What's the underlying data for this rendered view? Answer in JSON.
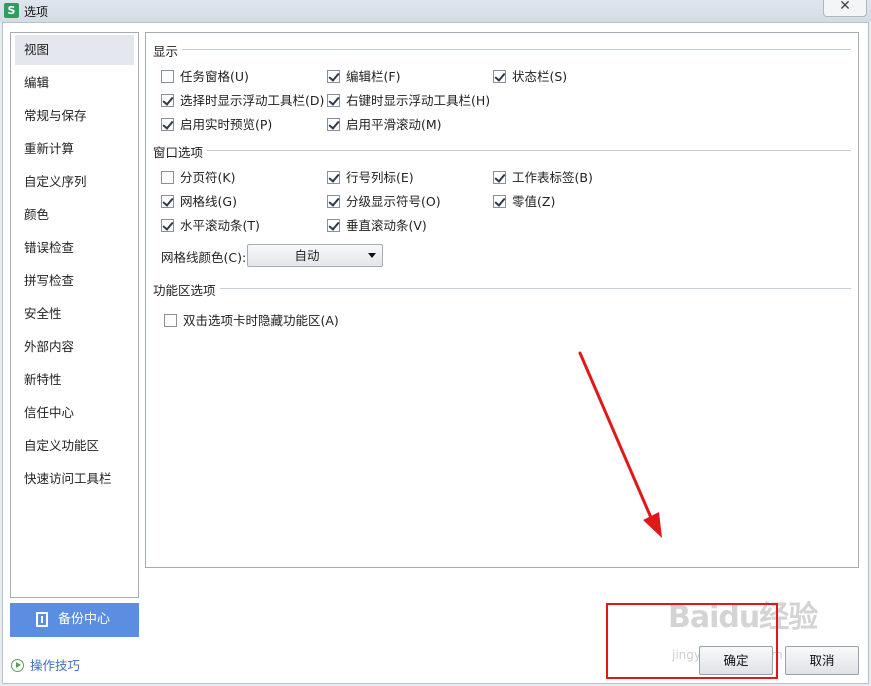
{
  "window": {
    "title": "选项",
    "app_icon_letter": "S",
    "close_glyph": "✕"
  },
  "sidebar": {
    "items": [
      {
        "label": "视图",
        "active": true
      },
      {
        "label": "编辑"
      },
      {
        "label": "常规与保存"
      },
      {
        "label": "重新计算"
      },
      {
        "label": "自定义序列"
      },
      {
        "label": "颜色"
      },
      {
        "label": "错误检查"
      },
      {
        "label": "拼写检查"
      },
      {
        "label": "安全性"
      },
      {
        "label": "外部内容"
      },
      {
        "label": "新特性"
      },
      {
        "label": "信任中心"
      },
      {
        "label": "自定义功能区"
      },
      {
        "label": "快速访问工具栏"
      }
    ]
  },
  "display": {
    "title": "显示",
    "options": [
      {
        "label": "任务窗格(U)",
        "checked": false
      },
      {
        "label": "编辑栏(F)",
        "checked": true
      },
      {
        "label": "状态栏(S)",
        "checked": true
      },
      {
        "label": "选择时显示浮动工具栏(D)",
        "checked": true
      },
      {
        "label": "右键时显示浮动工具栏(H)",
        "checked": true
      },
      {
        "label": "启用实时预览(P)",
        "checked": true
      },
      {
        "label": "启用平滑滚动(M)",
        "checked": true
      }
    ]
  },
  "window_options": {
    "title": "窗口选项",
    "options": [
      {
        "label": "分页符(K)",
        "checked": false
      },
      {
        "label": "行号列标(E)",
        "checked": true
      },
      {
        "label": "工作表标签(B)",
        "checked": true
      },
      {
        "label": "网格线(G)",
        "checked": true
      },
      {
        "label": "分级显示符号(O)",
        "checked": true
      },
      {
        "label": "零值(Z)",
        "checked": true
      },
      {
        "label": "水平滚动条(T)",
        "checked": true
      },
      {
        "label": "垂直滚动条(V)",
        "checked": true
      }
    ],
    "gridline_color_label": "网格线颜色(C):",
    "gridline_color_value": "自动"
  },
  "ribbon": {
    "title": "功能区选项",
    "options": [
      {
        "label": "双击选项卡时隐藏功能区(A)",
        "checked": false
      }
    ]
  },
  "footer": {
    "backup_label": "备份中心",
    "tips_label": "操作技巧",
    "ok_label": "确定",
    "cancel_label": "取消"
  },
  "watermark": {
    "text": "Baidu经验",
    "sub": "jingyan.baidu.com"
  },
  "colors": {
    "accent_blue": "#5b8ee0",
    "annotation_red": "#e01818",
    "checkbox_check": "#2c3a4a"
  }
}
